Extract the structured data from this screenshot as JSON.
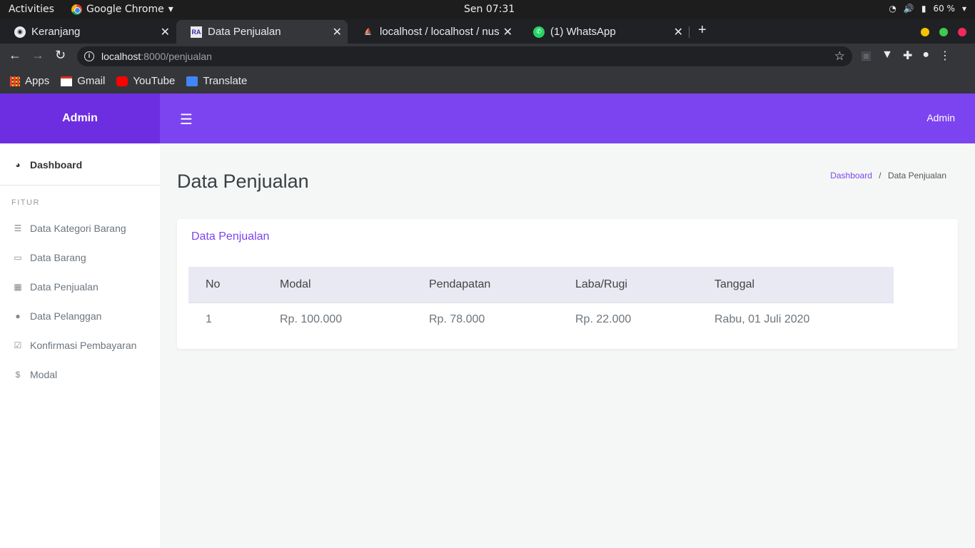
{
  "os": {
    "activities": "Activities",
    "app_name": "Google Chrome",
    "clock": "Sen 07:31",
    "battery": "60 %"
  },
  "tabs": [
    {
      "title": "Keranjang"
    },
    {
      "title": "Data Penjualan"
    },
    {
      "title": "localhost / localhost / nus"
    },
    {
      "title": "(1) WhatsApp"
    }
  ],
  "address": {
    "host": "localhost",
    "path": ":8000/penjualan"
  },
  "bookmarks": [
    "Apps",
    "Gmail",
    "YouTube",
    "Translate"
  ],
  "brand": "Admin",
  "header_user": "Admin",
  "sidebar": {
    "dashboard": "Dashboard",
    "section": "FITUR",
    "items": [
      "Data Kategori Barang",
      "Data Barang",
      "Data Penjualan",
      "Data Pelanggan",
      "Konfirmasi Pembayaran",
      "Modal"
    ]
  },
  "page_title": "Data Penjualan",
  "breadcrumb": {
    "home": "Dashboard",
    "sep": "/",
    "current": "Data Penjualan"
  },
  "card_title": "Data Penjualan",
  "table": {
    "headers": [
      "No",
      "Modal",
      "Pendapatan",
      "Laba/Rugi",
      "Tanggal"
    ],
    "rows": [
      [
        "1",
        "Rp. 100.000",
        "Rp. 78.000",
        "Rp. 22.000",
        "Rabu, 01 Juli 2020"
      ]
    ]
  },
  "colors": {
    "brand": "#6c2ee0",
    "header": "#7c44f0",
    "accent": "#7c44f0"
  }
}
